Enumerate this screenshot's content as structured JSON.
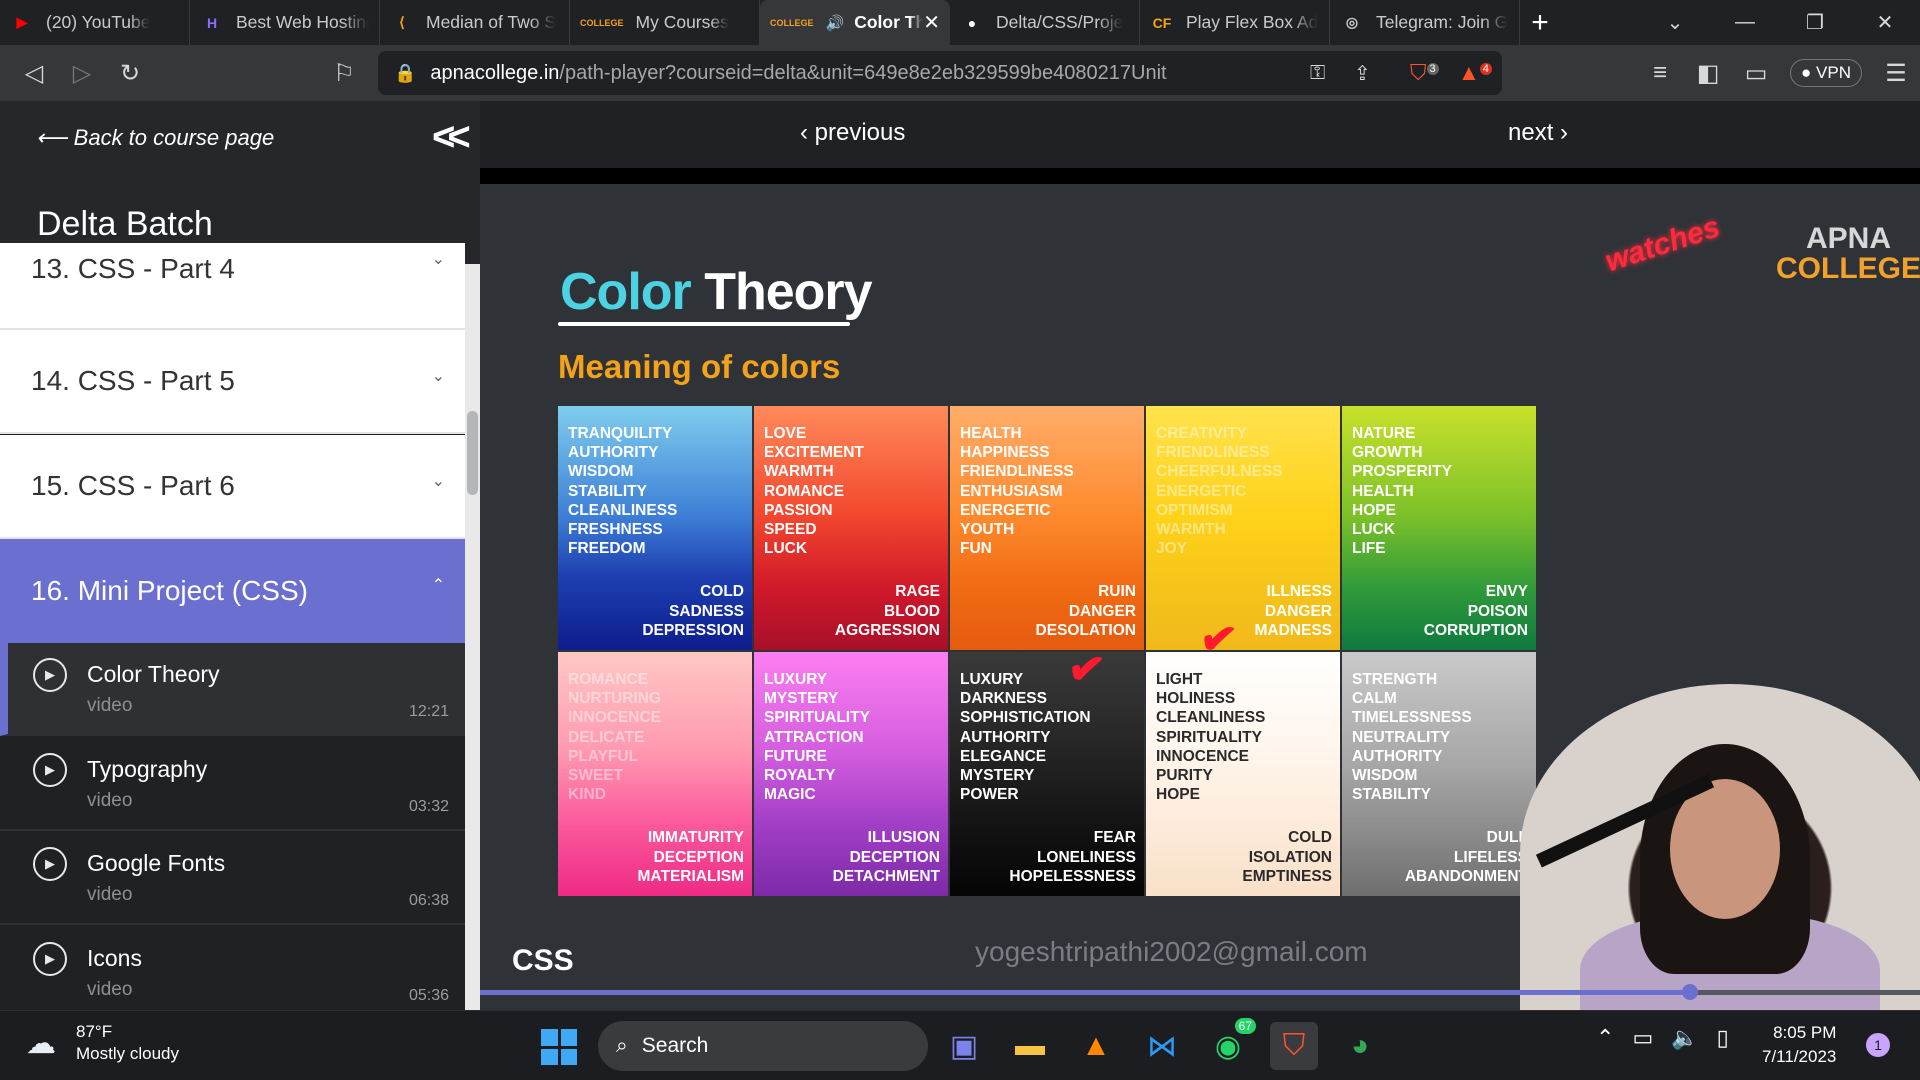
{
  "tabs": [
    {
      "label": "(20) YouTube",
      "icon": "youtube-icon",
      "color": "#ff0000"
    },
    {
      "label": "Best Web Hosting",
      "icon": "hostinger-icon",
      "color": "#673de6"
    },
    {
      "label": "Median of Two S",
      "icon": "leetcode-icon",
      "color": "#ffa116"
    },
    {
      "label": "My Courses",
      "icon": "apna-college-icon",
      "color": "#f4a21a"
    },
    {
      "label": "Color The",
      "icon": "apna-college-icon",
      "color": "#f4a21a",
      "active": true
    },
    {
      "label": "Delta/CSS/Proje",
      "icon": "github-icon",
      "color": "#ffffff"
    },
    {
      "label": "Play Flex Box Ad",
      "icon": "codingfantasy-icon",
      "color": "#f4a21a"
    },
    {
      "label": "Telegram: Join G",
      "icon": "globe-icon",
      "color": "#c8cacd"
    }
  ],
  "address": {
    "domain": "apnacollege.in",
    "path": "/path-player?courseid=delta&unit=649e8e2eb329599be4080217Unit"
  },
  "badges": {
    "brave_shields": "3",
    "brave_rewards": "4"
  },
  "vpn_label": "VPN",
  "sidebar": {
    "back": "Back to course page",
    "course": "Delta Batch",
    "sections": [
      {
        "label": "13. CSS - Part 4"
      },
      {
        "label": "14. CSS - Part 5"
      },
      {
        "label": "15. CSS - Part 6"
      },
      {
        "label": "16. Mini Project (CSS)",
        "open": true
      }
    ],
    "lessons": [
      {
        "title": "Color Theory",
        "kind": "video",
        "duration": "12:21",
        "selected": true
      },
      {
        "title": "Typography",
        "kind": "video",
        "duration": "03:32"
      },
      {
        "title": "Google Fonts",
        "kind": "video",
        "duration": "06:38"
      },
      {
        "title": "Icons",
        "kind": "video",
        "duration": "05:36"
      }
    ]
  },
  "player": {
    "prev": "‹ previous",
    "next": "next ›",
    "progress_fraction": 0.84,
    "slide": {
      "title_part1": "Color",
      "title_part2": "Theory",
      "subtitle": "Meaning of colors",
      "logo_a1": "APNA",
      "logo_a2": "COLLEGE",
      "logo_w": "watches",
      "footer": "CSS",
      "watermark": "yogeshtripathi2002@gmail.com",
      "colors": [
        {
          "bg": "linear-gradient(#7fcdee,#3e7fd6 45%,#1d3fb0 70%,#0e1d8c)",
          "pos": [
            "TRANQUILITY",
            "AUTHORITY",
            "WISDOM",
            "STABILITY",
            "CLEANLINESS",
            "FRESHNESS",
            "FREEDOM"
          ],
          "neg": [
            "COLD",
            "SADNESS",
            "DEPRESSION"
          ]
        },
        {
          "bg": "linear-gradient(#ff8a5a,#f2472e 45%,#d0182a 75%,#a8102a)",
          "pos": [
            "LOVE",
            "EXCITEMENT",
            "WARMTH",
            "ROMANCE",
            "PASSION",
            "SPEED",
            "LUCK"
          ],
          "neg": [
            "RAGE",
            "BLOOD",
            "AGGRESSION"
          ]
        },
        {
          "bg": "linear-gradient(#ffad6a,#ff8a2d 45%,#f06a12 75%,#e55b10)",
          "pos": [
            "HEALTH",
            "HAPPINESS",
            "FRIENDLINESS",
            "ENTHUSIASM",
            "ENERGETIC",
            "YOUTH",
            "FUN"
          ],
          "neg": [
            "RUIN",
            "DANGER",
            "DESOLATION"
          ]
        },
        {
          "bg": "linear-gradient(#ffe24d,#ffd21a 45%,#f4c41a 75%,#f1b81a)",
          "pos": [
            "CREATIVITY",
            "FRIENDLINESS",
            "CHEERFULNESS",
            "ENERGETIC",
            "OPTIMISM",
            "WARMTH",
            "JOY"
          ],
          "neg": [
            "ILLNESS",
            "DANGER",
            "MADNESS"
          ],
          "faded": true
        },
        {
          "bg": "linear-gradient(#c8e02a,#7cc12a 45%,#2f9a3a 75%,#0f7a3f)",
          "pos": [
            "NATURE",
            "GROWTH",
            "PROSPERITY",
            "HEALTH",
            "HOPE",
            "LUCK",
            "LIFE"
          ],
          "neg": [
            "ENVY",
            "POISON",
            "CORRUPTION"
          ]
        },
        {
          "bg": "linear-gradient(#ffc8c4,#ff9ab0 40%,#fb5a9c 70%,#ee2a86)",
          "pos": [
            "ROMANCE",
            "NURTURING",
            "INNOCENCE",
            "DELICATE",
            "PLAYFUL",
            "SWEET",
            "KIND"
          ],
          "neg": [
            "IMMATURITY",
            "DECEPTION",
            "MATERIALISM"
          ],
          "faded": true
        },
        {
          "bg": "linear-gradient(#fb7ff0,#d55ee0 40%,#a33fc7 70%,#7d2aa8)",
          "pos": [
            "LUXURY",
            "MYSTERY",
            "SPIRITUALITY",
            "ATTRACTION",
            "FUTURE",
            "ROYALTY",
            "MAGIC"
          ],
          "neg": [
            "ILLUSION",
            "DECEPTION",
            "DETACHMENT"
          ]
        },
        {
          "bg": "linear-gradient(#3a3a3a,#222 45%,#111 75%,#050505)",
          "pos": [
            "LUXURY",
            "DARKNESS",
            "SOPHISTICATION",
            "AUTHORITY",
            "ELEGANCE",
            "MYSTERY",
            "POWER"
          ],
          "neg": [
            "FEAR",
            "LONELINESS",
            "HOPELESSNESS"
          ]
        },
        {
          "bg": "linear-gradient(#ffffff,#fff4ea 45%,#fde9d7 75%,#f9e0c8)",
          "pos": [
            "LIGHT",
            "HOLINESS",
            "CLEANLINESS",
            "SPIRITUALITY",
            "INNOCENCE",
            "PURITY",
            "HOPE"
          ],
          "neg": [
            "COLD",
            "ISOLATION",
            "EMPTINESS"
          ],
          "dark": true
        },
        {
          "bg": "linear-gradient(#c9c9c9,#a8a8a8 45%,#8a8a8a 75%,#6e6e6e)",
          "pos": [
            "STRENGTH",
            "CALM",
            "TIMELESSNESS",
            "NEUTRALITY",
            "AUTHORITY",
            "WISDOM",
            "STABILITY"
          ],
          "neg": [
            "DULL",
            "LIFELESS",
            "ABANDONMENT"
          ]
        }
      ]
    }
  },
  "taskbar": {
    "temp": "87°F",
    "weather": "Mostly cloudy",
    "search": "Search",
    "whatsapp_badge": "67",
    "time": "8:05 PM",
    "date": "7/11/2023",
    "notifications": "1"
  }
}
